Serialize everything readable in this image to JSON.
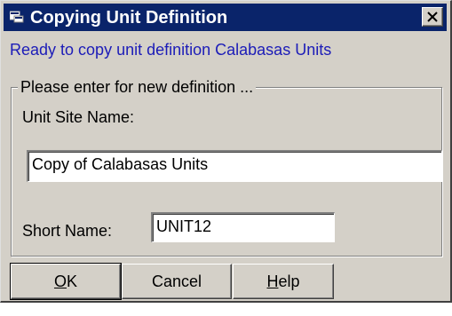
{
  "window": {
    "title": "Copying Unit Definition",
    "icon": "window-app-icon",
    "close_icon": "close-icon"
  },
  "status_message": "Ready to copy unit definition Calabasas Units",
  "group": {
    "legend": "Please enter for new definition ...",
    "unit_site_name_label": "Unit Site Name:",
    "unit_site_name_value": "Copy of Calabasas Units",
    "short_name_label": "Short Name:",
    "short_name_value": "UNIT12"
  },
  "buttons": {
    "ok_mnemonic": "O",
    "ok_rest": "K",
    "cancel": "Cancel",
    "help_mnemonic": "H",
    "help_rest": "elp"
  },
  "colors": {
    "titlebar": "#0a246a",
    "dialog_face": "#d4d0c8",
    "status_text": "#1c1cb8"
  }
}
